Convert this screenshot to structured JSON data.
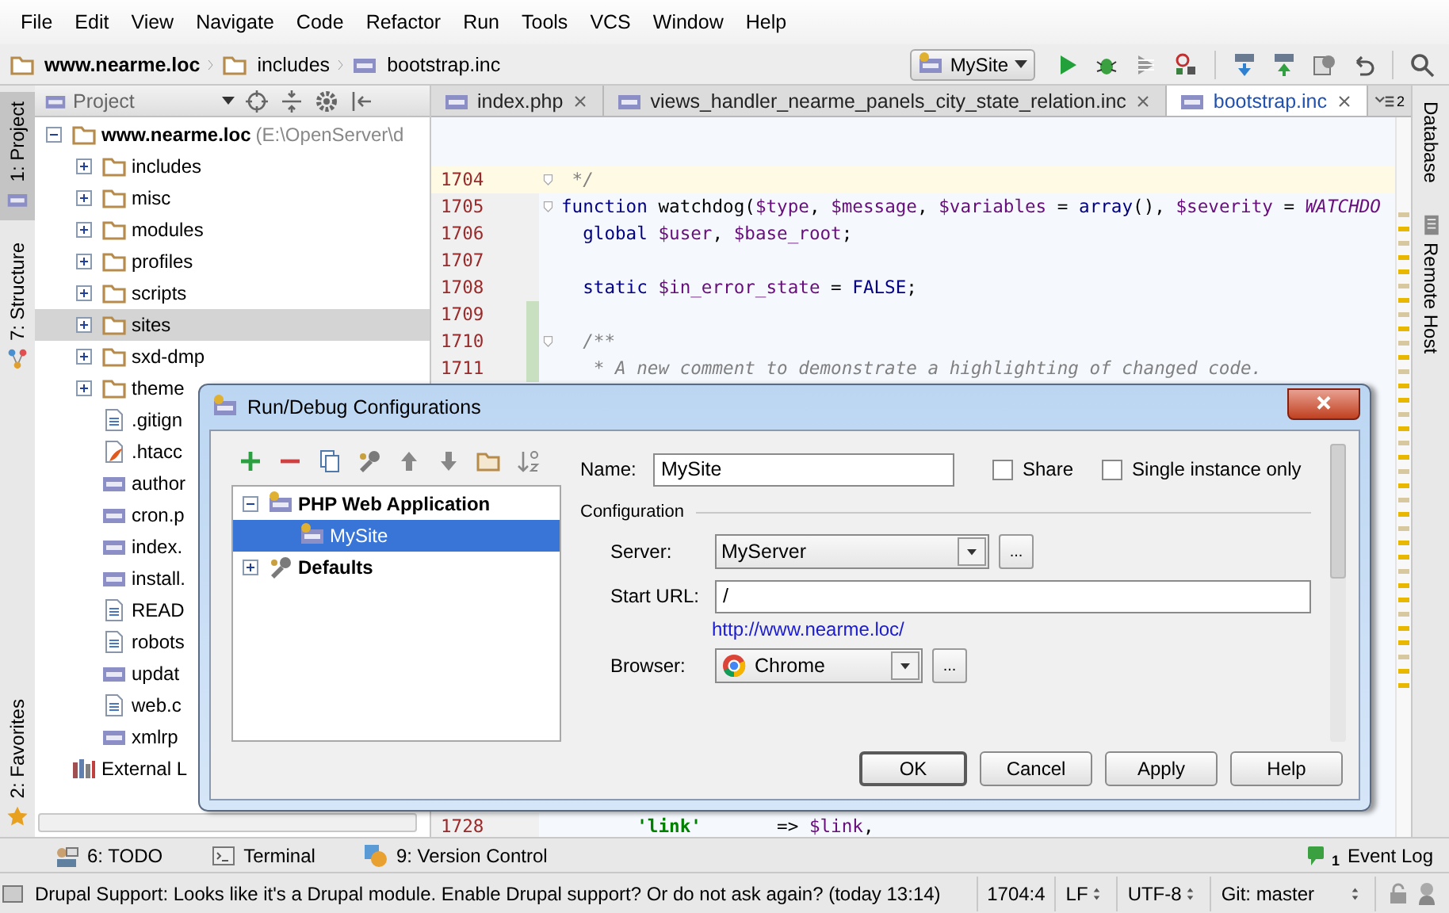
{
  "menu": [
    "File",
    "Edit",
    "View",
    "Navigate",
    "Code",
    "Refactor",
    "Run",
    "Tools",
    "VCS",
    "Window",
    "Help"
  ],
  "breadcrumbs": [
    {
      "label": "www.nearme.loc",
      "kind": "project"
    },
    {
      "label": "includes",
      "kind": "folder"
    },
    {
      "label": "bootstrap.inc",
      "kind": "php"
    }
  ],
  "run_config": {
    "label": "MySite"
  },
  "left_tabs": [
    {
      "label": "1: Project",
      "kind": "php",
      "selected": true
    },
    {
      "label": "7: Structure",
      "kind": "structure",
      "selected": false
    },
    {
      "label": "2: Favorites",
      "kind": "star",
      "selected": false
    }
  ],
  "right_tabs": [
    {
      "label": "Database",
      "kind": "none"
    },
    {
      "label": "Remote Host",
      "kind": "server"
    }
  ],
  "project_panel": {
    "title": "Project",
    "tree": [
      {
        "label": "www.nearme.loc",
        "path": "(E:\\OpenServer\\d",
        "kind": "project",
        "expanded": true,
        "selected": false,
        "children": [
          {
            "label": "includes",
            "kind": "folder",
            "expanded": false,
            "selected": false
          },
          {
            "label": "misc",
            "kind": "folder",
            "expanded": false,
            "selected": false
          },
          {
            "label": "modules",
            "kind": "folder",
            "expanded": false,
            "selected": false
          },
          {
            "label": "profiles",
            "kind": "folder",
            "expanded": false,
            "selected": false
          },
          {
            "label": "scripts",
            "kind": "folder",
            "expanded": false,
            "selected": false
          },
          {
            "label": "sites",
            "kind": "folder",
            "expanded": false,
            "selected": true
          },
          {
            "label": "sxd-dmp",
            "kind": "folder",
            "expanded": false,
            "selected": false
          },
          {
            "label": "theme",
            "kind": "folder",
            "expanded": false,
            "selected": false
          },
          {
            "label": ".gitign",
            "kind": "text",
            "selected": false
          },
          {
            "label": ".htacc",
            "kind": "htaccess",
            "selected": false
          },
          {
            "label": "author",
            "kind": "php",
            "selected": false
          },
          {
            "label": "cron.p",
            "kind": "php",
            "selected": false
          },
          {
            "label": "index.",
            "kind": "php",
            "selected": false
          },
          {
            "label": "install.",
            "kind": "php",
            "selected": false
          },
          {
            "label": "READ",
            "kind": "text",
            "selected": false
          },
          {
            "label": "robots",
            "kind": "text",
            "selected": false
          },
          {
            "label": "updat",
            "kind": "php",
            "selected": false
          },
          {
            "label": "web.c",
            "kind": "text",
            "selected": false
          },
          {
            "label": "xmlrp",
            "kind": "php",
            "selected": false
          }
        ]
      },
      {
        "label": "External L",
        "kind": "library",
        "selected": false
      }
    ]
  },
  "editor": {
    "tabs": [
      {
        "label": "index.php",
        "selected": false
      },
      {
        "label": "views_handler_nearme_panels_city_state_relation.inc",
        "selected": false
      },
      {
        "label": "bootstrap.inc",
        "selected": true
      }
    ],
    "tab_count": "2",
    "lines": [
      {
        "number": "1704",
        "current": true,
        "changed": false,
        "fold": true,
        "tokens": [
          {
            "text": " */",
            "kind": "comment"
          }
        ]
      },
      {
        "number": "1705",
        "current": false,
        "changed": false,
        "fold": true,
        "tokens": [
          {
            "text": "function",
            "kind": "keyword"
          },
          {
            "text": " watchdog(",
            "kind": "plain"
          },
          {
            "text": "$type",
            "kind": "var"
          },
          {
            "text": ", ",
            "kind": "plain"
          },
          {
            "text": "$message",
            "kind": "var"
          },
          {
            "text": ", ",
            "kind": "plain"
          },
          {
            "text": "$variables",
            "kind": "var"
          },
          {
            "text": " = ",
            "kind": "plain"
          },
          {
            "text": "array",
            "kind": "keyword"
          },
          {
            "text": "(), ",
            "kind": "plain"
          },
          {
            "text": "$severity",
            "kind": "var"
          },
          {
            "text": " = ",
            "kind": "plain"
          },
          {
            "text": "WATCHDO",
            "kind": "const"
          }
        ]
      },
      {
        "number": "1706",
        "current": false,
        "changed": false,
        "fold": false,
        "tokens": [
          {
            "text": "  global",
            "kind": "keyword"
          },
          {
            "text": " $user",
            "kind": "var"
          },
          {
            "text": ", ",
            "kind": "plain"
          },
          {
            "text": "$base_root",
            "kind": "var"
          },
          {
            "text": ";",
            "kind": "plain"
          }
        ]
      },
      {
        "number": "1707",
        "current": false,
        "changed": false,
        "fold": false
      },
      {
        "number": "1708",
        "current": false,
        "changed": false,
        "fold": false,
        "tokens": [
          {
            "text": "  static",
            "kind": "keyword"
          },
          {
            "text": " $in_error_state",
            "kind": "var"
          },
          {
            "text": " = ",
            "kind": "plain"
          },
          {
            "text": "FALSE",
            "kind": "keyword"
          },
          {
            "text": ";",
            "kind": "plain"
          }
        ]
      },
      {
        "number": "1709",
        "current": false,
        "changed": true,
        "fold": false
      },
      {
        "number": "1710",
        "current": false,
        "changed": true,
        "fold": true,
        "tokens": [
          {
            "text": "  /**",
            "kind": "comment"
          }
        ]
      },
      {
        "number": "1711",
        "current": false,
        "changed": true,
        "fold": false,
        "tokens": [
          {
            "text": "   * A new comment to demonstrate a highlighting of changed code.",
            "kind": "comment"
          }
        ]
      },
      {
        "number": "1728",
        "current": false,
        "changed": false,
        "fold": false,
        "hidden_before": true,
        "tokens": [
          {
            "text": "       'link'",
            "kind": "string"
          },
          {
            "text": "       => ",
            "kind": "plain"
          },
          {
            "text": "$link",
            "kind": "var"
          },
          {
            "text": ",",
            "kind": "plain"
          }
        ]
      }
    ]
  },
  "tool_windows": [
    {
      "label": "6: TODO",
      "kind": "todo"
    },
    {
      "label": "Terminal",
      "kind": "terminal"
    },
    {
      "label": "9: Version Control",
      "kind": "vcs"
    }
  ],
  "event_log": {
    "label": "Event Log",
    "count": "1"
  },
  "status_bar": {
    "message": "Drupal Support: Looks like it's a Drupal module. Enable Drupal support? Or do not ask again? (today 13:14)",
    "position": "1704:4",
    "line_separator": "LF",
    "encoding": "UTF-8",
    "branch": "Git: master"
  },
  "dialog": {
    "title": "Run/Debug Configurations",
    "tree": [
      {
        "label": "PHP Web Application",
        "kind": "phpapp",
        "expanded": true,
        "selected": false,
        "children": [
          {
            "label": "MySite",
            "kind": "phpapp",
            "selected": true
          }
        ]
      },
      {
        "label": "Defaults",
        "kind": "wrench",
        "expanded": false,
        "selected": false
      }
    ],
    "name_label": "Name:",
    "name_value": "MySite",
    "share": {
      "label": "Share",
      "checked": false
    },
    "single_instance": {
      "label": "Single instance only",
      "checked": false
    },
    "section": "Configuration",
    "server_label": "Server:",
    "server_value": "MyServer",
    "url_label": "Start URL:",
    "url_value": "/",
    "url_link": "http://www.nearme.loc/",
    "browser_label": "Browser:",
    "browser_value": "Chrome",
    "browse_button": "...",
    "buttons": [
      {
        "label": "OK",
        "default": true
      },
      {
        "label": "Cancel",
        "default": false
      },
      {
        "label": "Apply",
        "default": false
      },
      {
        "label": "Help",
        "default": false
      }
    ]
  }
}
